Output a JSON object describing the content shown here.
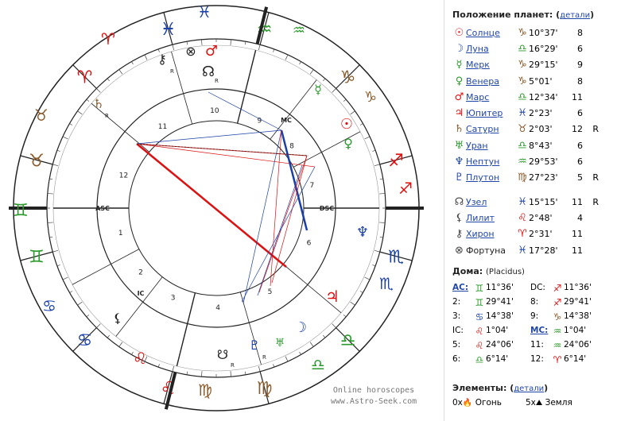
{
  "chart": {
    "watermark_line1": "Online horoscopes",
    "watermark_line2": "www.Astro-Seek.com",
    "asc_label": "ASC",
    "dsc_label": "DSC",
    "mc_label": "MC",
    "ic_label": "IC",
    "house_numbers": [
      "1",
      "2",
      "3",
      "4",
      "5",
      "6",
      "7",
      "8",
      "9",
      "10",
      "11",
      "12"
    ],
    "retro_mark": "R",
    "outer_signs": [
      {
        "glyph": "♓",
        "color": "#1a3fa8",
        "angle": 0
      },
      {
        "glyph": "♒",
        "color": "#2b9a2b",
        "angle": 30
      },
      {
        "glyph": "♑",
        "color": "#8a5a2b",
        "angle": 60
      },
      {
        "glyph": "♐",
        "color": "#d11",
        "angle": 90
      },
      {
        "glyph": "♏",
        "color": "#1a3fa8",
        "angle": 120
      },
      {
        "glyph": "♎",
        "color": "#2b9a2b",
        "angle": 150
      },
      {
        "glyph": "♍",
        "color": "#8a5a2b",
        "angle": 180
      },
      {
        "glyph": "♌",
        "color": "#d11",
        "angle": 210
      },
      {
        "glyph": "♋",
        "color": "#1a3fa8",
        "angle": 240
      },
      {
        "glyph": "♊",
        "color": "#2b9a2b",
        "angle": 270
      },
      {
        "glyph": "♉",
        "color": "#8a5a2b",
        "angle": 300
      },
      {
        "glyph": "♈",
        "color": "#d11",
        "angle": 330
      }
    ]
  },
  "planets": {
    "title": "Положение планет:",
    "details_link": "детали",
    "rows": [
      {
        "icon": "☉",
        "icon_color": "#d11",
        "name": "Солнце",
        "sign": "♑",
        "sign_color": "#8a5a2b",
        "pos": "10°37'",
        "house": "8",
        "retro": "",
        "link": true
      },
      {
        "icon": "☽",
        "icon_color": "#1a3fa8",
        "name": "Луна",
        "sign": "♎",
        "sign_color": "#2b9a2b",
        "pos": "16°29'",
        "house": "6",
        "retro": "",
        "link": true
      },
      {
        "icon": "☿",
        "icon_color": "#2b9a2b",
        "name": "Мерк",
        "sign": "♑",
        "sign_color": "#8a5a2b",
        "pos": "29°15'",
        "house": "9",
        "retro": "",
        "link": true
      },
      {
        "icon": "♀",
        "icon_color": "#2b9a2b",
        "name": "Венера",
        "sign": "♑",
        "sign_color": "#8a5a2b",
        "pos": "5°01'",
        "house": "8",
        "retro": "",
        "link": true
      },
      {
        "icon": "♂",
        "icon_color": "#d11",
        "name": "Марс",
        "sign": "♎",
        "sign_color": "#2b9a2b",
        "pos": "12°34'",
        "house": "11",
        "retro": "",
        "link": true
      },
      {
        "icon": "♃",
        "icon_color": "#d11",
        "name": "Юпитер",
        "sign": "♓",
        "sign_color": "#1a3fa8",
        "pos": "2°23'",
        "house": "6",
        "retro": "",
        "link": true
      },
      {
        "icon": "♄",
        "icon_color": "#8a5a2b",
        "name": "Сатурн",
        "sign": "♉",
        "sign_color": "#8a5a2b",
        "pos": "2°03'",
        "house": "12",
        "retro": "R",
        "link": true
      },
      {
        "icon": "♅",
        "icon_color": "#2b9a2b",
        "name": "Уран",
        "sign": "♎",
        "sign_color": "#2b9a2b",
        "pos": "8°43'",
        "house": "6",
        "retro": "",
        "link": true
      },
      {
        "icon": "♆",
        "icon_color": "#1a3fa8",
        "name": "Нептун",
        "sign": "♒",
        "sign_color": "#2b9a2b",
        "pos": "29°53'",
        "house": "6",
        "retro": "",
        "link": true
      },
      {
        "icon": "♇",
        "icon_color": "#1a3fa8",
        "name": "Плутон",
        "sign": "♍",
        "sign_color": "#8a5a2b",
        "pos": "27°23'",
        "house": "5",
        "retro": "R",
        "link": true
      },
      {
        "icon": "☊",
        "icon_color": "#444",
        "name": "Узел",
        "sign": "♓",
        "sign_color": "#1a3fa8",
        "pos": "15°15'",
        "house": "11",
        "retro": "R",
        "link": true,
        "gap": true
      },
      {
        "icon": "⚸",
        "icon_color": "#444",
        "name": "Лилит",
        "sign": "♌",
        "sign_color": "#d11",
        "pos": "2°48'",
        "house": "4",
        "retro": "",
        "link": true
      },
      {
        "icon": "⚷",
        "icon_color": "#444",
        "name": "Хирон",
        "sign": "♈",
        "sign_color": "#d11",
        "pos": "2°31'",
        "house": "11",
        "retro": "",
        "link": true
      },
      {
        "icon": "⊗",
        "icon_color": "#444",
        "name": "Фортуна",
        "sign": "♓",
        "sign_color": "#1a3fa8",
        "pos": "17°28'",
        "house": "11",
        "retro": "",
        "link": false
      }
    ]
  },
  "houses": {
    "title": "Дома:",
    "system": "(Placidus)",
    "rows": [
      {
        "k1": "AC:",
        "k1u": true,
        "s1": "♊",
        "c1": "#2b9a2b",
        "v1": "11°36'",
        "k2": "DC:",
        "k2u": false,
        "s2": "♐",
        "c2": "#d11",
        "v2": "11°36'"
      },
      {
        "k1": "2:",
        "k1u": false,
        "s1": "♊",
        "c1": "#2b9a2b",
        "v1": "29°41'",
        "k2": "8:",
        "k2u": false,
        "s2": "♐",
        "c2": "#d11",
        "v2": "29°41'"
      },
      {
        "k1": "3:",
        "k1u": false,
        "s1": "♋",
        "c1": "#1a3fa8",
        "v1": "14°38'",
        "k2": "9:",
        "k2u": false,
        "s2": "♑",
        "c2": "#8a5a2b",
        "v2": "14°38'"
      },
      {
        "k1": "IC:",
        "k1u": false,
        "s1": "♌",
        "c1": "#d11",
        "v1": "1°04'",
        "k2": "MC:",
        "k2u": true,
        "s2": "♒",
        "c2": "#2b9a2b",
        "v2": "1°04'"
      },
      {
        "k1": "5:",
        "k1u": false,
        "s1": "♌",
        "c1": "#d11",
        "v1": "24°06'",
        "k2": "11:",
        "k2u": false,
        "s2": "♒",
        "c2": "#2b9a2b",
        "v2": "24°06'"
      },
      {
        "k1": "6:",
        "k1u": false,
        "s1": "♎",
        "c1": "#2b9a2b",
        "v1": "6°14'",
        "k2": "12:",
        "k2u": false,
        "s2": "♈",
        "c2": "#d11",
        "v2": "6°14'"
      }
    ]
  },
  "elements": {
    "title": "Элементы:",
    "details_link": "детали",
    "items": [
      {
        "count": "0x",
        "label": "Огонь",
        "icon": "🔥"
      },
      {
        "count": "5x",
        "label": "Земля",
        "icon": "⛰"
      }
    ]
  }
}
